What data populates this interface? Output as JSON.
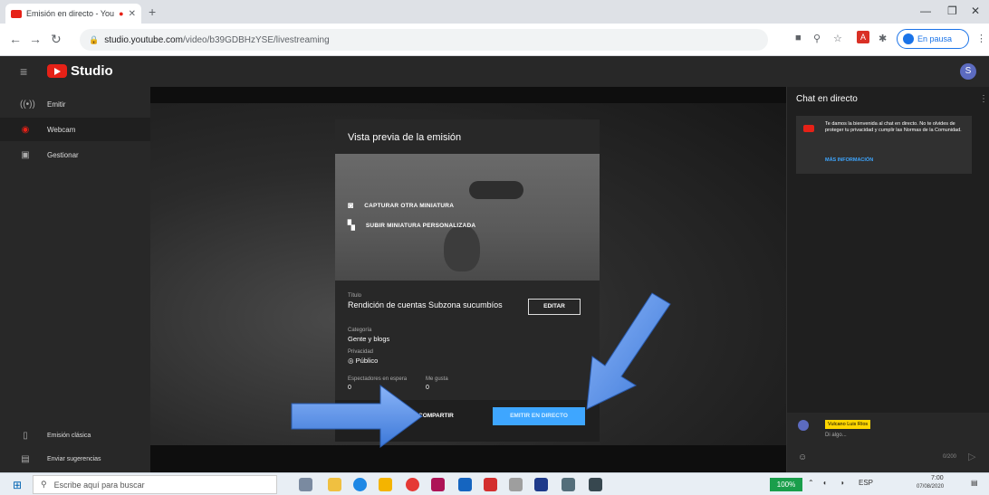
{
  "browser": {
    "tab_title": "Emisión en directo - YouTu",
    "url_host": "studio.youtube.com",
    "url_path": "/video/b39GDBHzYSE/livestreaming",
    "profile_label": "En pausa"
  },
  "header": {
    "app_name": "Studio",
    "avatar_initial": "S"
  },
  "sidebar": {
    "items": [
      {
        "label": "Emitir"
      },
      {
        "label": "Webcam"
      },
      {
        "label": "Gestionar"
      }
    ],
    "bottom_items": [
      {
        "label": "Emisión clásica"
      },
      {
        "label": "Enviar sugerencias"
      }
    ]
  },
  "dialog": {
    "title": "Vista previa de la emisión",
    "capture_label": "CAPTURAR OTRA MINIATURA",
    "upload_label": "SUBIR MINIATURA PERSONALIZADA",
    "title_label": "Título",
    "title_value": "Rendición de cuentas Subzona sucumbíos",
    "edit_label": "EDITAR",
    "category_label": "Categoría",
    "category_value": "Gente y blogs",
    "privacy_label": "Privacidad",
    "privacy_value": "Público",
    "viewers_label": "Espectadores en espera",
    "viewers_value": "0",
    "likes_label": "Me gusta",
    "likes_value": "0",
    "share_label": "COMPARTIR",
    "go_live_label": "EMITIR EN DIRECTO"
  },
  "chat": {
    "title": "Chat en directo",
    "notice_text": "Te damos la bienvenida al chat en directo. No te olvides de proteger tu privacidad y cumplir las Normas de la Comunidad.",
    "notice_link": "MÁS INFORMACIÓN",
    "user_name": "Vulcano Luis Ríos",
    "input_placeholder": "Di algo...",
    "char_count": "0/200"
  },
  "taskbar": {
    "search_placeholder": "Escribe aquí para buscar",
    "battery": "100%",
    "language": "ESP",
    "time": "7:00",
    "date": "07/08/2020"
  },
  "colors": {
    "accent_red": "#e62117",
    "go_live_blue": "#3ea6ff",
    "annotation_arrow": "#4a86e8"
  }
}
